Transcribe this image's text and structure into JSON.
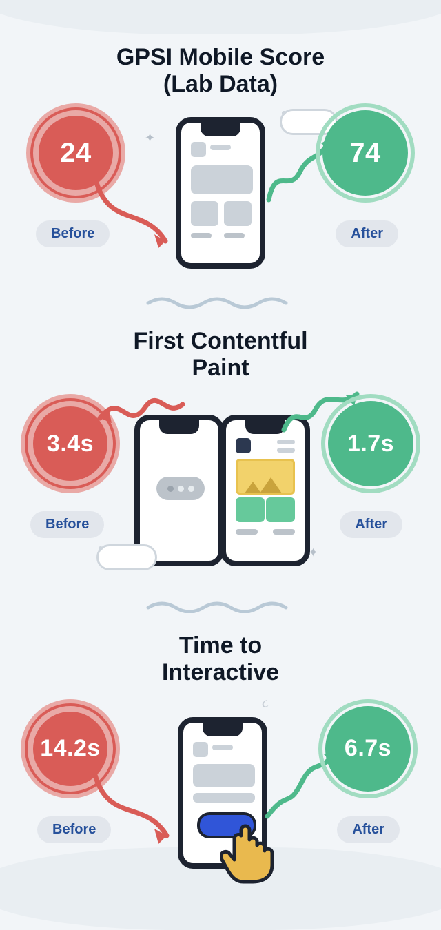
{
  "colors": {
    "before": "#D95C57",
    "after": "#4EB98B",
    "label": "#27519B"
  },
  "metrics": [
    {
      "title": "GPSI Mobile Score (Lab Data)",
      "before_value": "24",
      "after_value": "74",
      "before_label": "Before",
      "after_label": "After"
    },
    {
      "title": "First Contentful Paint",
      "before_value": "3.4s",
      "after_value": "1.7s",
      "before_label": "Before",
      "after_label": "After"
    },
    {
      "title": "Time to Interactive",
      "before_value": "14.2s",
      "after_value": "6.7s",
      "before_label": "Before",
      "after_label": "After"
    }
  ]
}
